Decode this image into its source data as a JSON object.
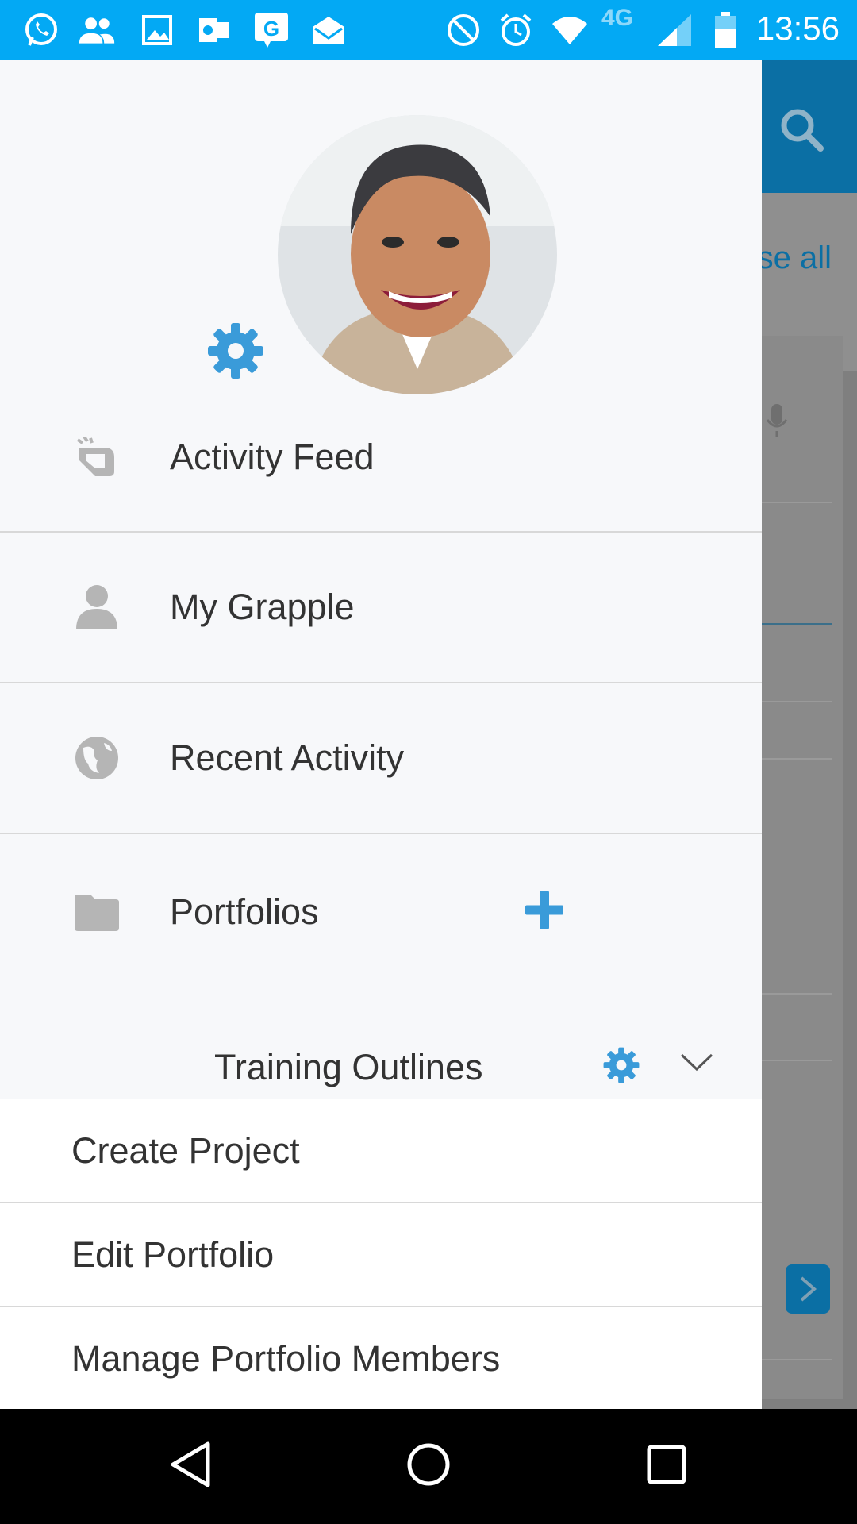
{
  "status_bar": {
    "time": "13:56",
    "network_label": "4G",
    "icons": [
      "whatsapp-icon",
      "people-icon",
      "gallery-icon",
      "outlook-icon",
      "grapple-notification-icon",
      "mail-icon",
      "do-not-disturb-icon",
      "alarm-icon",
      "wifi-icon",
      "signal-icon",
      "battery-icon"
    ]
  },
  "background_app": {
    "close_all_fragment": "se all"
  },
  "drawer": {
    "nav_items": [
      {
        "label": "Activity Feed",
        "icon": "activity-feed-icon"
      },
      {
        "label": "My Grapple",
        "icon": "person-icon"
      },
      {
        "label": "Recent Activity",
        "icon": "globe-icon"
      },
      {
        "label": "Portfolios",
        "icon": "folder-icon"
      }
    ],
    "portfolio": {
      "name": "Training Outlines"
    },
    "portfolio_menu": [
      {
        "label": "Create Project"
      },
      {
        "label": "Edit Portfolio"
      },
      {
        "label": "Manage Portfolio Members"
      }
    ]
  },
  "colors": {
    "accent": "#3a9bd9",
    "status_bar": "#03a9f4",
    "header": "#0b6fa4",
    "icon_gray": "#b5b5b5",
    "text": "#333333"
  }
}
